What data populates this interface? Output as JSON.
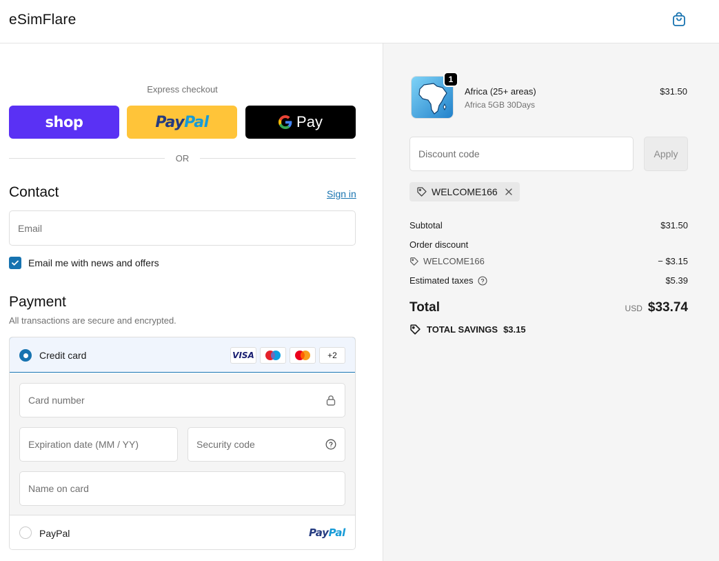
{
  "header": {
    "brand": "eSimFlare",
    "cart_icon": "shopping-bag-icon"
  },
  "express": {
    "label": "Express checkout",
    "shop_label": "shop",
    "paypal_part1": "Pay",
    "paypal_part2": "Pal",
    "gpay_label": "Pay",
    "or_text": "OR"
  },
  "contact": {
    "title": "Contact",
    "signin": "Sign in",
    "email_placeholder": "Email",
    "newsletter_label": "Email me with news and offers",
    "newsletter_checked": true
  },
  "payment": {
    "title": "Payment",
    "subtitle": "All transactions are secure and encrypted.",
    "credit_card_label": "Credit card",
    "card_badges": [
      "VISA",
      "maestro",
      "mastercard",
      "+2"
    ],
    "card_number_placeholder": "Card number",
    "expiry_placeholder": "Expiration date (MM / YY)",
    "cvc_placeholder": "Security code",
    "name_placeholder": "Name on card",
    "paypal_label": "PayPal",
    "paypal_logo_part1": "Pay",
    "paypal_logo_part2": "Pal"
  },
  "order": {
    "item_name": "Africa (25+ areas)",
    "item_variant": "Africa 5GB 30Days",
    "item_price": "$31.50",
    "item_qty": "1",
    "discount_placeholder": "Discount code",
    "apply_label": "Apply",
    "applied_code": "WELCOME166",
    "subtotal_label": "Subtotal",
    "subtotal_value": "$31.50",
    "order_discount_label": "Order discount",
    "discount_code": "WELCOME166",
    "discount_value": "− $3.15",
    "taxes_label": "Estimated taxes",
    "taxes_value": "$5.39",
    "total_label": "Total",
    "currency": "USD",
    "total_value": "$33.74",
    "savings_label": "TOTAL SAVINGS",
    "savings_value": "$3.15"
  },
  "colors": {
    "accent": "#1773b0",
    "shop": "#5a31f4",
    "paypal": "#ffc439"
  }
}
